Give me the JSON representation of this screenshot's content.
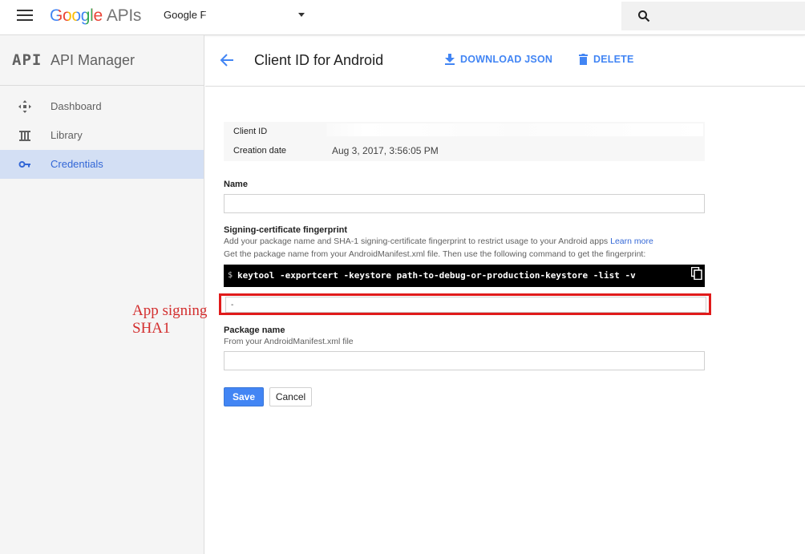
{
  "topbar": {
    "logo_google": "Google",
    "logo_apis": "APIs",
    "project_name": "Google F",
    "icons": {
      "menu": "hamburger-icon",
      "search": "search-icon",
      "dropdown": "caret-down-icon"
    }
  },
  "sidebar": {
    "mark": "API",
    "title": "API Manager",
    "items": [
      {
        "label": "Dashboard",
        "icon": "dashboard-icon"
      },
      {
        "label": "Library",
        "icon": "library-icon"
      },
      {
        "label": "Credentials",
        "icon": "key-icon",
        "active": true
      }
    ]
  },
  "header": {
    "title": "Client ID for Android",
    "download_label": "DOWNLOAD JSON",
    "delete_label": "DELETE"
  },
  "details": {
    "client_id_label": "Client ID",
    "client_id_value": "",
    "creation_date_label": "Creation date",
    "creation_date_value": "Aug 3, 2017, 3:56:05 PM"
  },
  "form": {
    "name_label": "Name",
    "name_value": "",
    "signing_label": "Signing-certificate fingerprint",
    "signing_hint_1": "Add your package name and SHA-1 signing-certificate fingerprint to restrict usage to your Android apps",
    "learn_more": "Learn more",
    "signing_hint_2": "Get the package name from your AndroidManifest.xml file. Then use the following command to get the fingerprint:",
    "command_prompt": "$",
    "command": "keytool -exportcert -keystore path-to-debug-or-production-keystore -list -v",
    "sha_value": "-",
    "package_label": "Package name",
    "package_hint": "From your AndroidManifest.xml file",
    "package_value": "",
    "save_label": "Save",
    "cancel_label": "Cancel"
  },
  "annotation": {
    "line1": "App signing",
    "line2": "SHA1"
  },
  "colors": {
    "accent": "#4285f4",
    "active_bg": "#d3dff4",
    "highlight": "#e01b1b"
  }
}
